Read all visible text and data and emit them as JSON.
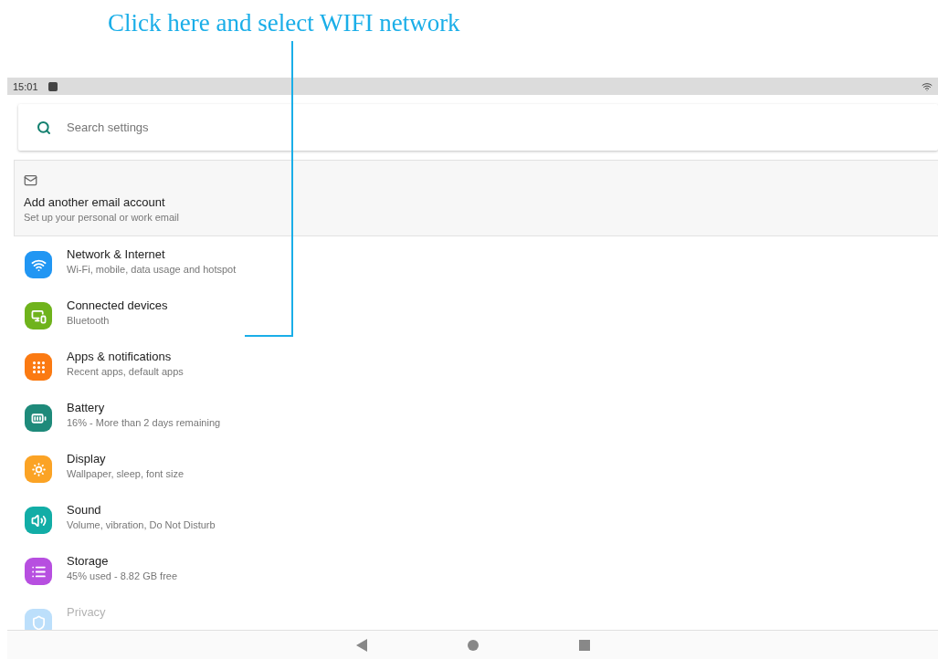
{
  "annotation": {
    "text": "Click here and select WIFI network"
  },
  "status_bar": {
    "time": "15:01"
  },
  "search": {
    "placeholder": "Search settings"
  },
  "suggestion": {
    "title": "Add another email account",
    "subtitle": "Set up your personal or work email"
  },
  "settings": [
    {
      "kind": "wifi",
      "color": "#2196f3",
      "title": "Network & Internet",
      "subtitle": "Wi-Fi, mobile, data usage and hotspot"
    },
    {
      "kind": "devices",
      "color": "#6fb31c",
      "title": "Connected devices",
      "subtitle": "Bluetooth"
    },
    {
      "kind": "apps",
      "color": "#fb7a12",
      "title": "Apps & notifications",
      "subtitle": "Recent apps, default apps"
    },
    {
      "kind": "battery",
      "color": "#1e8a7a",
      "title": "Battery",
      "subtitle": "16% - More than 2 days remaining"
    },
    {
      "kind": "display",
      "color": "#fba325",
      "title": "Display",
      "subtitle": "Wallpaper, sleep, font size"
    },
    {
      "kind": "sound",
      "color": "#12ada6",
      "title": "Sound",
      "subtitle": "Volume, vibration, Do Not Disturb"
    },
    {
      "kind": "storage",
      "color": "#b74fe0",
      "title": "Storage",
      "subtitle": "45% used - 8.82 GB free"
    },
    {
      "kind": "privacy",
      "color": "#bcdffb",
      "title": "Privacy"
    }
  ]
}
